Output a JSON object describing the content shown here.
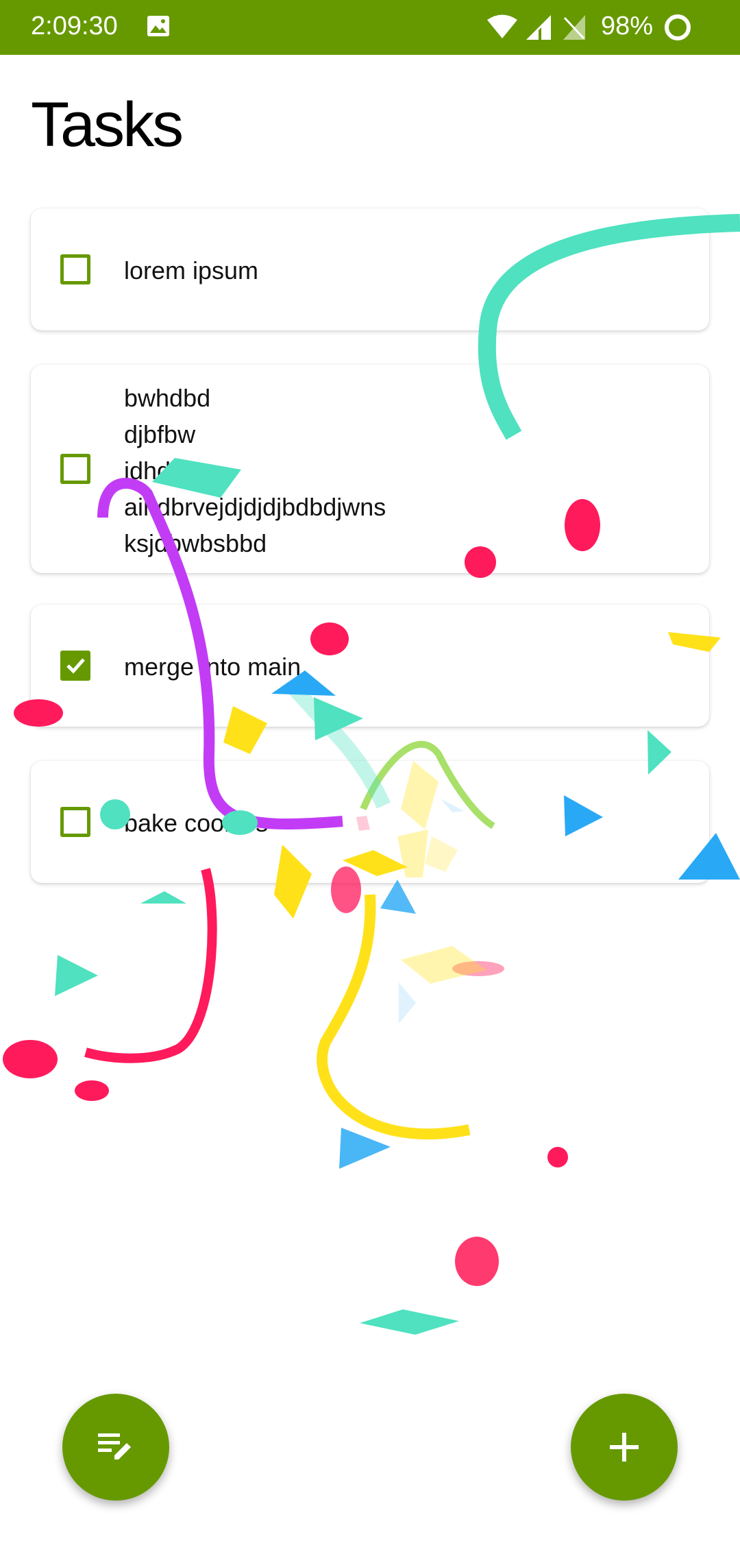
{
  "status_bar": {
    "time": "2:09:30",
    "battery": "98%",
    "icons": [
      "image-icon",
      "wifi-icon",
      "signal-icon",
      "no-sim-icon",
      "battery-ring-icon"
    ]
  },
  "page": {
    "title": "Tasks"
  },
  "tasks": [
    {
      "lines": [
        "lorem ipsum"
      ],
      "checked": false
    },
    {
      "lines": [
        "bwhdbd",
        "djbfbw",
        "jdhd",
        "aihdbrvejdjdjdjbdbdjwns",
        "ksjdbwbsbbd"
      ],
      "checked": false
    },
    {
      "lines": [
        "merge into main"
      ],
      "checked": true
    },
    {
      "lines": [
        "bake cookies"
      ],
      "checked": false
    }
  ],
  "fabs": {
    "left_icon": "edit-list-icon",
    "right_icon": "add-icon"
  },
  "colors": {
    "accent": "#669900",
    "confetti": [
      "#4fe1c0",
      "#ff1a5c",
      "#c23cf5",
      "#ffe11a",
      "#29a9f5",
      "#a8e06a"
    ]
  }
}
